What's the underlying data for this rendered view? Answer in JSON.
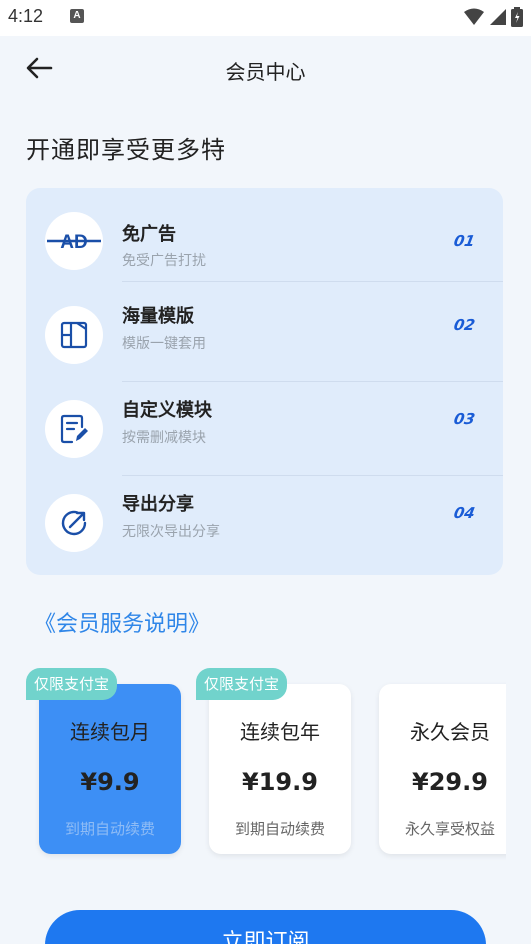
{
  "status_bar": {
    "time": "4:12",
    "notification_letter": "A"
  },
  "header": {
    "title": "会员中心"
  },
  "headline": "开通即享受更多特",
  "features": [
    {
      "title": "免广告",
      "subtitle": "免受广告打扰",
      "number": "01",
      "icon": "no-ad-icon",
      "icon_text": "AD"
    },
    {
      "title": "海量模版",
      "subtitle": "模版一键套用",
      "number": "02",
      "icon": "template-icon"
    },
    {
      "title": "自定义模块",
      "subtitle": "按需删减模块",
      "number": "03",
      "icon": "edit-icon"
    },
    {
      "title": "导出分享",
      "subtitle": "无限次导出分享",
      "number": "04",
      "icon": "share-icon"
    }
  ],
  "service_link": "《会员服务说明》",
  "plans": [
    {
      "name": "连续包月",
      "price": "¥9.9",
      "note": "到期自动续费",
      "badge": "仅限支付宝",
      "selected": true
    },
    {
      "name": "连续包年",
      "price": "¥19.9",
      "note": "到期自动续费",
      "badge": "仅限支付宝",
      "selected": false
    },
    {
      "name": "永久会员",
      "price": "¥29.9",
      "note": "永久享受权益",
      "badge": "",
      "selected": false
    }
  ],
  "subscribe_label": "立即订阅",
  "colors": {
    "accent": "#1e78f0",
    "selected_plan": "#3d8ff5",
    "badge": "#71d3cc",
    "feature_bg": "#e0ecfb",
    "number": "#1a5cd6"
  }
}
